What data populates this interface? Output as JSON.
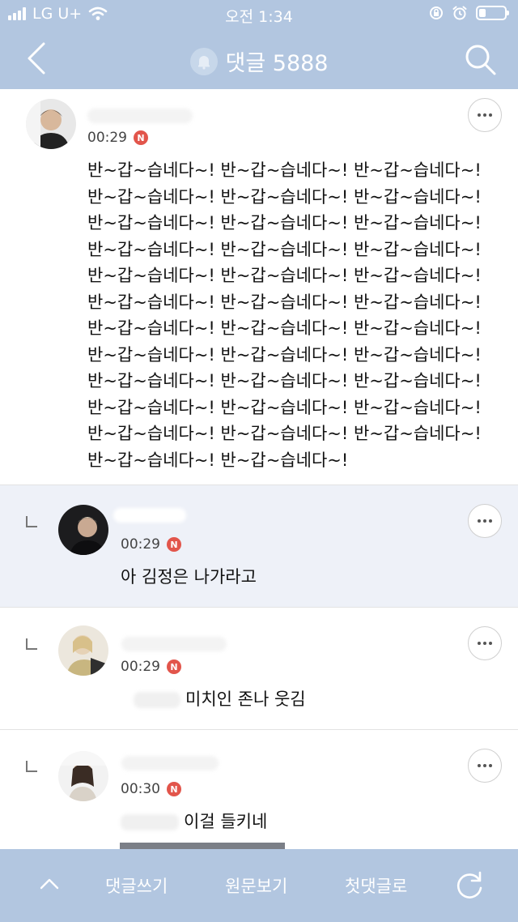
{
  "status": {
    "carrier": "LG U+",
    "time": "오전 1:34"
  },
  "header": {
    "title": "댓글 5888",
    "back_icon": "chevron-left-icon",
    "bell_icon": "bell-icon",
    "search_icon": "search-icon"
  },
  "comments": [
    {
      "time": "00:29",
      "badge": "N",
      "lines": [
        "반~갑~습네다~! 반~갑~습네다~! 반~갑~습네다~!",
        "반~갑~습네다~! 반~갑~습네다~! 반~갑~습네다~!",
        "반~갑~습네다~! 반~갑~습네다~! 반~갑~습네다~!",
        "반~갑~습네다~! 반~갑~습네다~! 반~갑~습네다~!",
        "반~갑~습네다~! 반~갑~습네다~! 반~갑~습네다~!",
        "반~갑~습네다~! 반~갑~습네다~! 반~갑~습네다~!",
        "반~갑~습네다~! 반~갑~습네다~! 반~갑~습네다~!",
        "반~갑~습네다~! 반~갑~습네다~! 반~갑~습네다~!",
        "반~갑~습네다~! 반~갑~습네다~! 반~갑~습네다~!",
        "반~갑~습네다~! 반~갑~습네다~! 반~갑~습네다~!",
        "반~갑~습네다~! 반~갑~습네다~! 반~갑~습네다~!",
        "반~갑~습네다~! 반~갑~습네다~!"
      ]
    },
    {
      "time": "00:29",
      "badge": "N",
      "text": "아 김정은 나가라고"
    },
    {
      "time": "00:29",
      "badge": "N",
      "text": "미치인 존나 웃김"
    },
    {
      "time": "00:30",
      "badge": "N",
      "text": "이걸 들키네"
    }
  ],
  "bottom": {
    "write": "댓글쓰기",
    "original": "원문보기",
    "first": "첫댓글로",
    "up_icon": "chevron-up-icon",
    "refresh_icon": "refresh-icon"
  },
  "colors": {
    "bar": "#b2c6e0",
    "highlight": "#eef1f8",
    "badge": "#e2554b"
  }
}
